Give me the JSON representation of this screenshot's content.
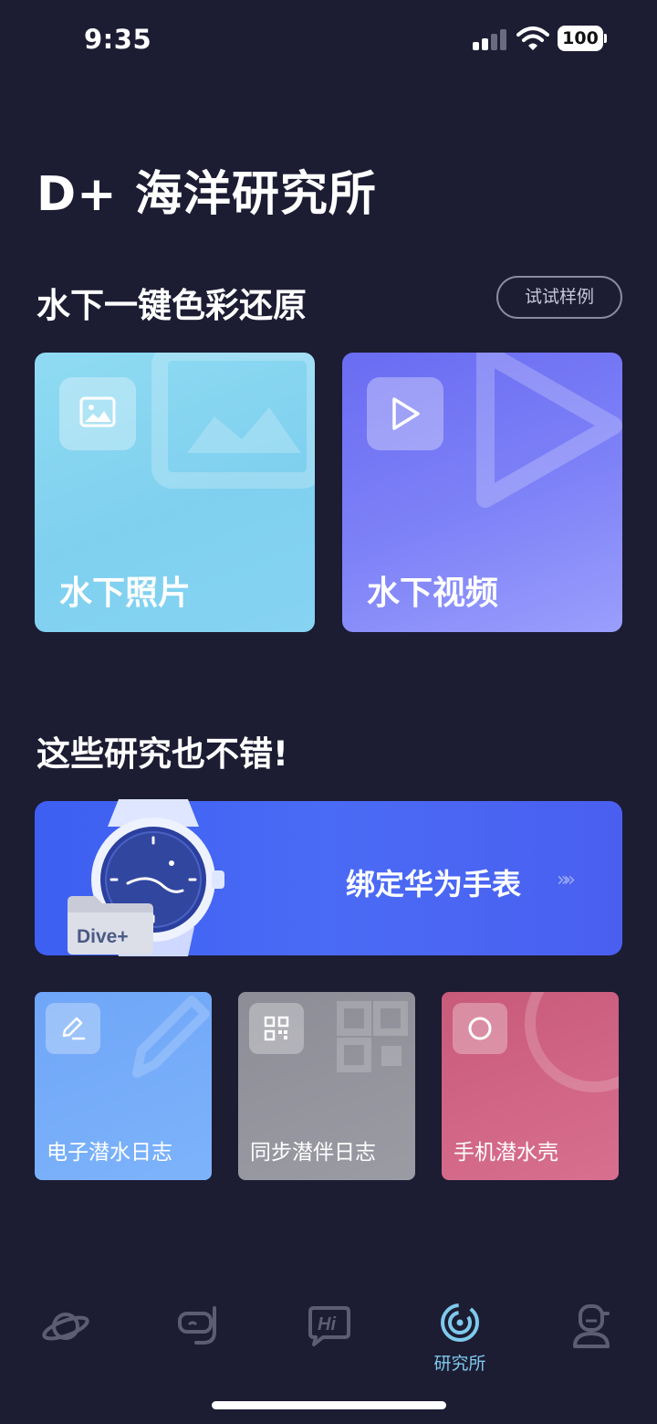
{
  "status_bar": {
    "time": "9:35",
    "battery": "100"
  },
  "header": {
    "title": "D+ 海洋研究所"
  },
  "color_restore": {
    "title": "水下一键色彩还原",
    "try_button": "试试样例",
    "cards": [
      {
        "label": "水下照片",
        "icon": "image-icon"
      },
      {
        "label": "水下视频",
        "icon": "play-icon"
      }
    ]
  },
  "more": {
    "title": "这些研究也不错!",
    "banner": {
      "label": "绑定华为手表",
      "folder_text": "Dive+",
      "arrows": "»»"
    },
    "tiles": [
      {
        "label": "电子潜水日志",
        "icon": "pen-icon"
      },
      {
        "label": "同步潜伴日志",
        "icon": "qr-code-icon"
      },
      {
        "label": "手机潜水壳",
        "icon": "circle-icon"
      }
    ]
  },
  "tab_bar": {
    "items": [
      {
        "icon": "planet-icon",
        "label": ""
      },
      {
        "icon": "diving-mask-icon",
        "label": ""
      },
      {
        "icon": "hi-chat-icon",
        "label": ""
      },
      {
        "icon": "research-institute-icon",
        "label": "研究所",
        "active": true
      },
      {
        "icon": "profile-diver-icon",
        "label": ""
      }
    ]
  },
  "colors": {
    "background": "#1c1c33",
    "photo_card": "#86d3f3",
    "video_card": "#7e82f7",
    "banner": "#4a6bf5",
    "log_tile": "#7db3fa",
    "sync_tile": "#9b9ba4",
    "case_tile": "#d86f8f",
    "active_tab": "#7ec9ec"
  }
}
